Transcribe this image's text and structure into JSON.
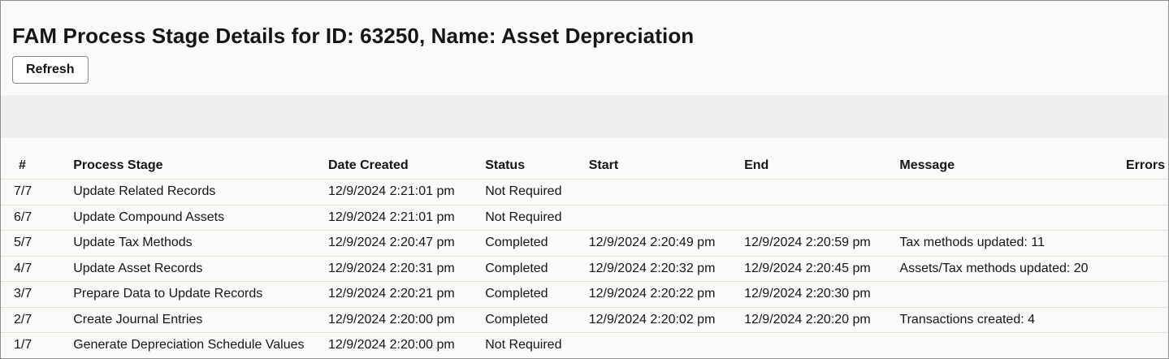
{
  "page": {
    "title": "FAM Process Stage Details for ID: 63250, Name: Asset Depreciation",
    "refresh_label": "Refresh"
  },
  "table": {
    "headers": [
      "#",
      "Process Stage",
      "Date Created",
      "Status",
      "Start",
      "End",
      "Message",
      "Errors"
    ],
    "rows": [
      {
        "num": "7/7",
        "stage": "Update Related Records",
        "created": "12/9/2024 2:21:01 pm",
        "status": "Not Required",
        "start": "",
        "end": "",
        "message": "",
        "errors": ""
      },
      {
        "num": "6/7",
        "stage": "Update Compound Assets",
        "created": "12/9/2024 2:21:01 pm",
        "status": "Not Required",
        "start": "",
        "end": "",
        "message": "",
        "errors": ""
      },
      {
        "num": "5/7",
        "stage": "Update Tax Methods",
        "created": "12/9/2024 2:20:47 pm",
        "status": "Completed",
        "start": "12/9/2024 2:20:49 pm",
        "end": "12/9/2024 2:20:59 pm",
        "message": "Tax methods updated: 11",
        "errors": ""
      },
      {
        "num": "4/7",
        "stage": "Update Asset Records",
        "created": "12/9/2024 2:20:31 pm",
        "status": "Completed",
        "start": "12/9/2024 2:20:32 pm",
        "end": "12/9/2024 2:20:45 pm",
        "message": "Assets/Tax methods updated: 20",
        "errors": ""
      },
      {
        "num": "3/7",
        "stage": "Prepare Data to Update Records",
        "created": "12/9/2024 2:20:21 pm",
        "status": "Completed",
        "start": "12/9/2024 2:20:22 pm",
        "end": "12/9/2024 2:20:30 pm",
        "message": "",
        "errors": ""
      },
      {
        "num": "2/7",
        "stage": "Create Journal Entries",
        "created": "12/9/2024 2:20:00 pm",
        "status": "Completed",
        "start": "12/9/2024 2:20:02 pm",
        "end": "12/9/2024 2:20:20 pm",
        "message": "Transactions created: 4",
        "errors": ""
      },
      {
        "num": "1/7",
        "stage": "Generate Depreciation Schedule Values",
        "created": "12/9/2024 2:20:00 pm",
        "status": "Not Required",
        "start": "",
        "end": "",
        "message": "",
        "errors": ""
      }
    ]
  }
}
